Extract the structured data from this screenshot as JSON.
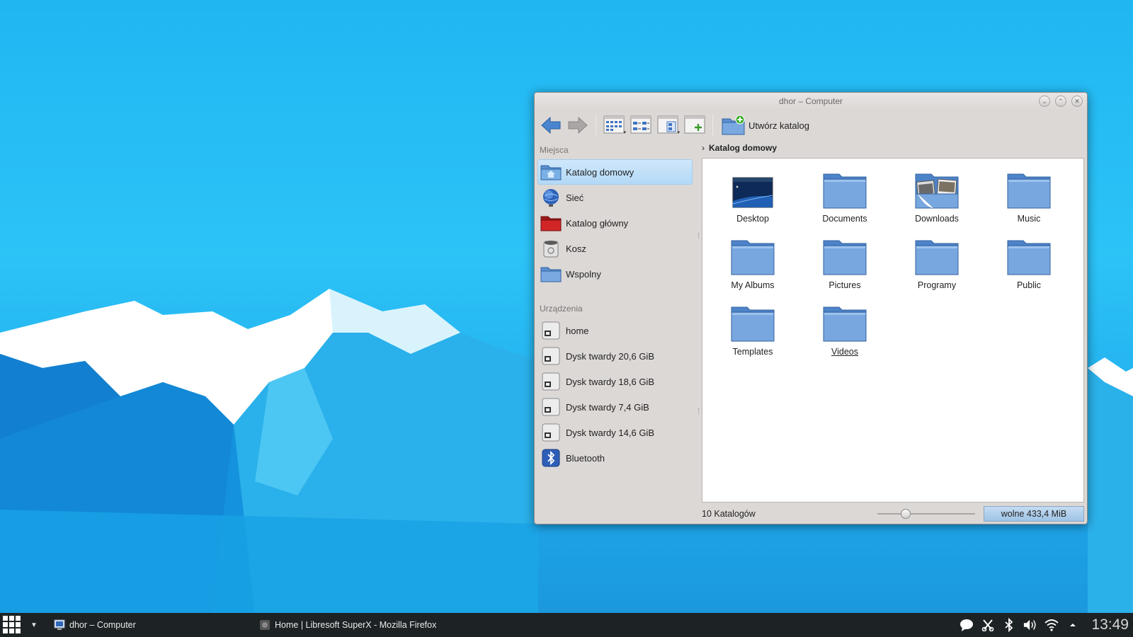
{
  "window": {
    "title": "dhor – Computer",
    "controls": [
      "minimize-icon",
      "maximize-icon",
      "close-icon"
    ]
  },
  "toolbar": {
    "back_icon": "arrow-left-icon",
    "forward_icon": "arrow-right-icon",
    "view_icons": "view-icons-icon",
    "view_compact": "view-compact-icon",
    "view_details": "view-details-icon",
    "new_tab": "new-tab-icon",
    "create_folder_label": "Utwórz katalog"
  },
  "sidebar": {
    "places_title": "Miejsca",
    "places": [
      {
        "label": "Katalog domowy",
        "icon": "home-folder-icon"
      },
      {
        "label": "Sieć",
        "icon": "network-globe-icon"
      },
      {
        "label": "Katalog główny",
        "icon": "root-folder-icon"
      },
      {
        "label": "Kosz",
        "icon": "trash-icon"
      },
      {
        "label": "Wspolny",
        "icon": "folder-icon"
      }
    ],
    "devices_title": "Urządzenia",
    "devices": [
      {
        "label": "home",
        "icon": "hard-drive-icon"
      },
      {
        "label": "Dysk twardy 20,6 GiB",
        "icon": "hard-drive-icon"
      },
      {
        "label": "Dysk twardy 18,6 GiB",
        "icon": "hard-drive-icon"
      },
      {
        "label": "Dysk twardy 7,4 GiB",
        "icon": "hard-drive-icon"
      },
      {
        "label": "Dysk twardy 14,6 GiB",
        "icon": "hard-drive-icon"
      },
      {
        "label": "Bluetooth",
        "icon": "bluetooth-icon"
      }
    ]
  },
  "breadcrumb": {
    "current": "Katalog domowy"
  },
  "files": [
    {
      "label": "Desktop",
      "icon": "desktop-folder-icon"
    },
    {
      "label": "Documents",
      "icon": "folder-icon"
    },
    {
      "label": "Downloads",
      "icon": "downloads-folder-icon"
    },
    {
      "label": "Music",
      "icon": "folder-icon"
    },
    {
      "label": "My Albums",
      "icon": "folder-icon"
    },
    {
      "label": "Pictures",
      "icon": "folder-icon"
    },
    {
      "label": "Programy",
      "icon": "folder-icon"
    },
    {
      "label": "Public",
      "icon": "folder-icon"
    },
    {
      "label": "Templates",
      "icon": "folder-icon"
    },
    {
      "label": "Videos",
      "icon": "folder-icon"
    }
  ],
  "status": {
    "count": "10 Katalogów",
    "zoom_level": 0.27,
    "free_space": "wolne 433,4 MiB"
  },
  "taskbar": {
    "launcher_icon": "app-grid-icon",
    "tasks": [
      {
        "label": "dhor – Computer",
        "icon": "file-manager-icon"
      },
      {
        "label": "Home | Libresoft SuperX - Mozilla Firefox",
        "icon": "firefox-icon"
      }
    ],
    "tray_icons": [
      "chat-icon",
      "scissors-icon",
      "bluetooth-icon",
      "volume-icon",
      "wifi-icon",
      "tray-expand-icon"
    ],
    "clock": "13:49"
  },
  "colors": {
    "selection": "#b3d9f6",
    "folder_blue": "#6f9fd8",
    "taskbar": "#1d2224"
  }
}
